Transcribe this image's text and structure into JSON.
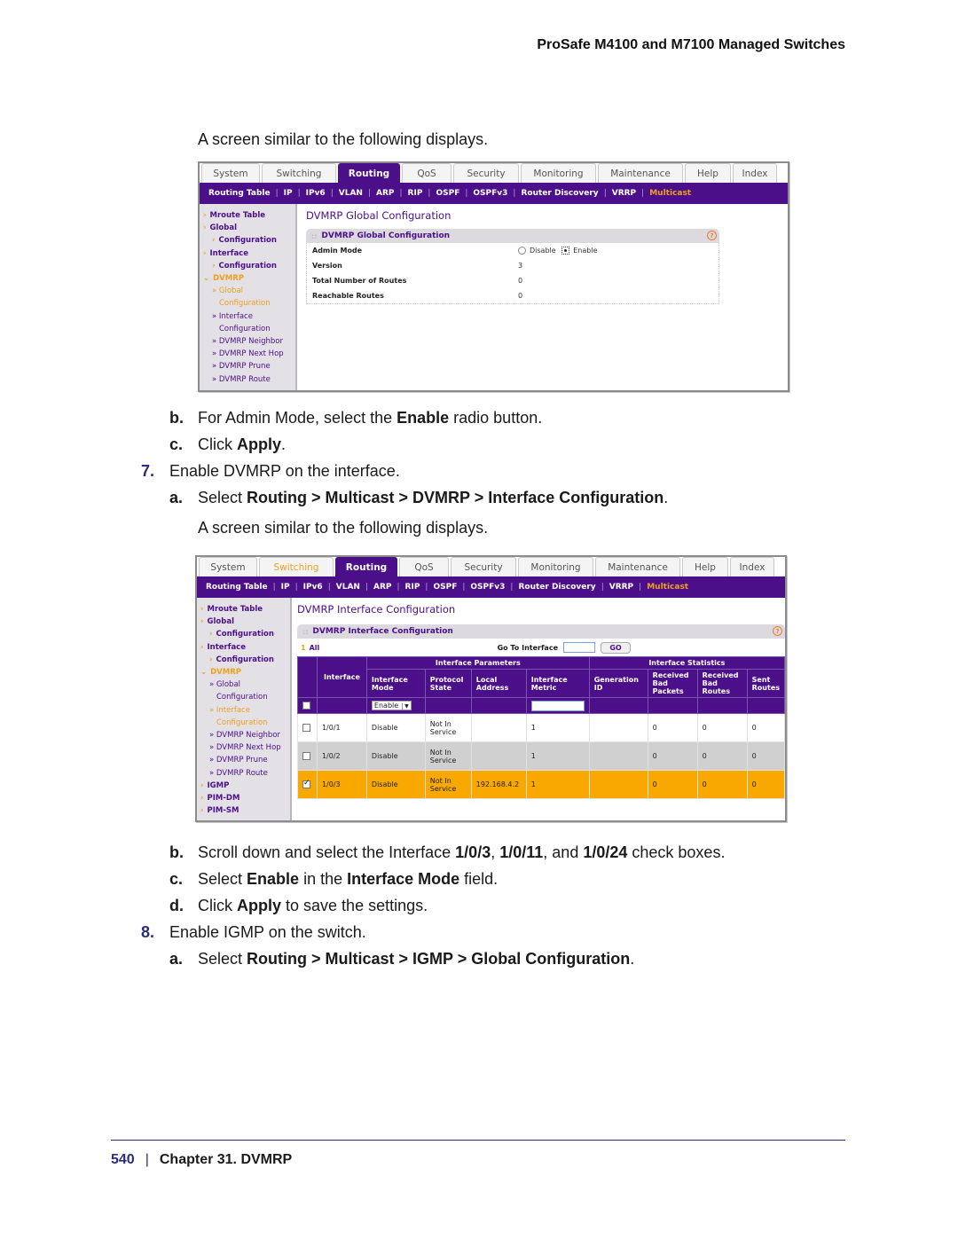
{
  "running_head": "ProSafe M4100 and M7100 Managed Switches",
  "paragraphs": {
    "intro1": "A screen similar to the following displays.",
    "step_b1": {
      "label": "b.",
      "pre": "For Admin Mode, select the ",
      "bold": "Enable",
      "post": " radio button."
    },
    "step_c1": {
      "label": "c.",
      "pre": "Click ",
      "bold": "Apply",
      "post": "."
    },
    "step_7": {
      "label": "7.",
      "text": "Enable DVMRP on the interface."
    },
    "step_a7": {
      "label": "a.",
      "pre": "Select ",
      "bold": "Routing > Multicast > DVMRP > Interface Configuration",
      "post": "."
    },
    "intro2": "A screen similar to the following displays.",
    "step_b7": {
      "label": "b.",
      "t1": "Scroll down and select the Interface ",
      "b1": "1/0/3",
      "t2": ", ",
      "b2": "1/0/11",
      "t3": ", and ",
      "b3": "1/0/24",
      "t4": " check boxes."
    },
    "step_c7": {
      "label": "c.",
      "t1": "Select ",
      "b1": "Enable",
      "t2": " in the ",
      "b2": "Interface Mode",
      "t3": " field."
    },
    "step_d7": {
      "label": "d.",
      "t1": "Click ",
      "b1": "Apply",
      "t2": " to save the settings."
    },
    "step_8": {
      "label": "8.",
      "text": "Enable IGMP on the switch."
    },
    "step_a8": {
      "label": "a.",
      "pre": "Select ",
      "bold": "Routing > Multicast > IGMP > Global Configuration",
      "post": "."
    }
  },
  "nav": {
    "tabs": [
      "System",
      "Switching",
      "Routing",
      "QoS",
      "Security",
      "Monitoring",
      "Maintenance",
      "Help",
      "Index"
    ],
    "active_tab": "Routing",
    "subnav": [
      "Routing Table",
      "IP",
      "IPv6",
      "VLAN",
      "ARP",
      "RIP",
      "OSPF",
      "OSPFv3",
      "Router Discovery",
      "VRRP",
      "Multicast"
    ],
    "active_subnav": "Multicast"
  },
  "shot1": {
    "sidebar": {
      "mroute": "Mroute Table",
      "global1": "Global",
      "global2": "Configuration",
      "iface1": "Interface",
      "iface2": "Configuration",
      "dvmrp": "DVMRP",
      "sub_global1": "» Global",
      "sub_global2": "Configuration",
      "sub_iface1": "» Interface",
      "sub_iface2": "Configuration",
      "neighbor": "» DVMRP Neighbor",
      "nexthop": "» DVMRP Next Hop",
      "prune": "» DVMRP Prune",
      "route": "» DVMRP Route"
    },
    "page_title": "DVMRP Global Configuration",
    "panel_title": "DVMRP Global Configuration",
    "help": "?",
    "rows": [
      {
        "label": "Admin Mode",
        "disable": "Disable",
        "enable": "Enable",
        "selected": "Enable"
      },
      {
        "label": "Version",
        "value": "3"
      },
      {
        "label": "Total Number of Routes",
        "value": "0"
      },
      {
        "label": "Reachable Routes",
        "value": "0"
      }
    ]
  },
  "shot2": {
    "tabs_highlight": "Switching",
    "sidebar": {
      "mroute": "Mroute Table",
      "global1": "Global",
      "global2": "Configuration",
      "iface1": "Interface",
      "iface2": "Configuration",
      "dvmrp": "DVMRP",
      "sub_global1": "» Global",
      "sub_global2": "Configuration",
      "sub_iface1": "» Interface",
      "sub_iface2": "Configuration",
      "neighbor": "» DVMRP Neighbor",
      "nexthop": "» DVMRP Next Hop",
      "prune": "» DVMRP Prune",
      "route": "» DVMRP Route",
      "igmp": "IGMP",
      "pimdm": "PIM-DM",
      "pimsm": "PIM-SM"
    },
    "page_title": "DVMRP Interface Configuration",
    "panel_title": "DVMRP Interface Configuration",
    "help": "?",
    "page_num": "1",
    "all_label": "All",
    "goto_label": "Go To Interface",
    "goto_value": "",
    "go_button": "GO",
    "group_params": "Interface Parameters",
    "group_stats": "Interface Statistics",
    "columns": [
      "Interface",
      "Interface Mode",
      "Protocol State",
      "Local Address",
      "Interface Metric",
      "Generation ID",
      "Received Bad Packets",
      "Received Bad Routes",
      "Sent Routes"
    ],
    "mode_select": "Enable",
    "rows": [
      {
        "checked": false,
        "interface": "1/0/1",
        "mode": "Disable",
        "state": "Not In Service",
        "address": "",
        "metric": "1",
        "gen_id": "",
        "bad_packets": "0",
        "bad_routes": "0",
        "sent_routes": "0"
      },
      {
        "checked": false,
        "interface": "1/0/2",
        "mode": "Disable",
        "state": "Not In Service",
        "address": "",
        "metric": "1",
        "gen_id": "",
        "bad_packets": "0",
        "bad_routes": "0",
        "sent_routes": "0"
      },
      {
        "checked": true,
        "interface": "1/0/3",
        "mode": "Disable",
        "state": "Not In Service",
        "address": "192.168.4.2",
        "metric": "1",
        "gen_id": "",
        "bad_packets": "0",
        "bad_routes": "0",
        "sent_routes": "0"
      }
    ]
  },
  "footer": {
    "page": "540",
    "sep": "|",
    "chapter": "Chapter 31.  DVMRP"
  },
  "colors": {
    "brand_purple": "#4b0f8a",
    "accent_orange": "#f9a800",
    "link_orange": "#f0a020",
    "heading_blue": "#2a2d7a"
  }
}
